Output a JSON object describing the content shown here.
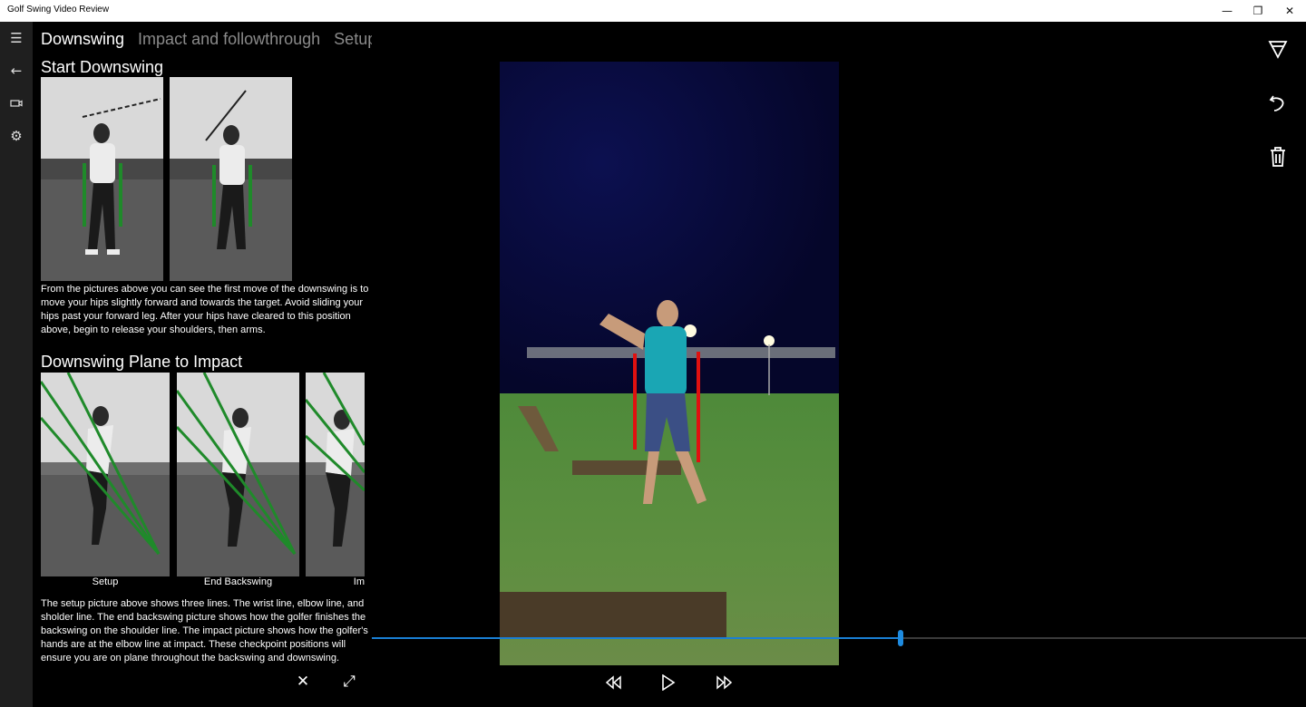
{
  "window": {
    "title": "Golf Swing Video Review",
    "minimize_glyph": "—",
    "maximize_glyph": "❐",
    "close_glyph": "✕"
  },
  "nav": {
    "items": [
      {
        "icon": "hamburger-menu-icon",
        "glyph": "☰"
      },
      {
        "icon": "back-arrow-icon",
        "glyph": "←"
      },
      {
        "icon": "video-camera-icon",
        "glyph": "▭"
      },
      {
        "icon": "gear-icon",
        "glyph": "⚙"
      }
    ]
  },
  "pivot": {
    "tabs": [
      "Downswing",
      "Impact and followthrough",
      "Setup"
    ],
    "selected": 0
  },
  "lesson": {
    "section1_title": "Start Downswing",
    "section1_text": "From the pictures above you can see the first move of the downswing is to move your hips slightly forward and towards the target. Avoid sliding your hips past your forward leg. After your hips have cleared to this position above, begin to release your shoulders, then arms.",
    "section2_title": "Downswing Plane to Impact",
    "captions": [
      "Setup",
      "End Backswing",
      "Im"
    ],
    "section2_text": "The setup picture above shows three lines. The wrist line, elbow line, and sholder line. The end backswing picture shows how the golfer finishes the backswing on the shoulder line. The impact picture shows how the golfer's hands are at the elbow line at impact. These checkpoint positions will ensure you are on plane throughout the backswing and downswing."
  },
  "left_actions": {
    "close_glyph": "✕",
    "expand_glyph": "⤢"
  },
  "playback": {
    "rewind_glyph": "⏪",
    "play_glyph": "▷",
    "forward_glyph": "⏩",
    "progress": 0.566
  },
  "tools": {
    "filter_icon": "funnel-icon",
    "undo_icon": "undo-icon",
    "delete_icon": "trash-icon"
  },
  "colors": {
    "accent": "#1e8be0",
    "overlay_line": "#e01010",
    "guide_line": "#1f8a2a"
  }
}
